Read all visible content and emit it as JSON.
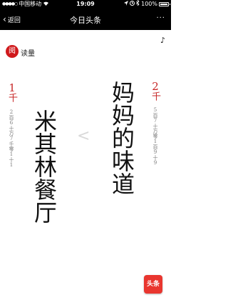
{
  "status_bar": {
    "carrier": "中国移动",
    "network": "",
    "time": "19:09",
    "battery": "100%"
  },
  "nav": {
    "back_label": "返回",
    "title": "今日头条",
    "more": "···"
  },
  "content": {
    "logo_char": "阅",
    "logo_text": "读量",
    "music_icon": "♪",
    "right": {
      "title": "妈妈的味道",
      "count_big": "2",
      "unit": "千",
      "count_full": "5百7十万零1百9十9"
    },
    "left": {
      "title": "米其林餐厅",
      "count_big": "1",
      "unit": "千",
      "count_full": "2百6十万7千零1十1"
    },
    "compare_symbol": "<",
    "app_badge": "头条"
  },
  "colors": {
    "accent": "#c72727",
    "bar": "#000000",
    "badge": "#e9362f"
  }
}
